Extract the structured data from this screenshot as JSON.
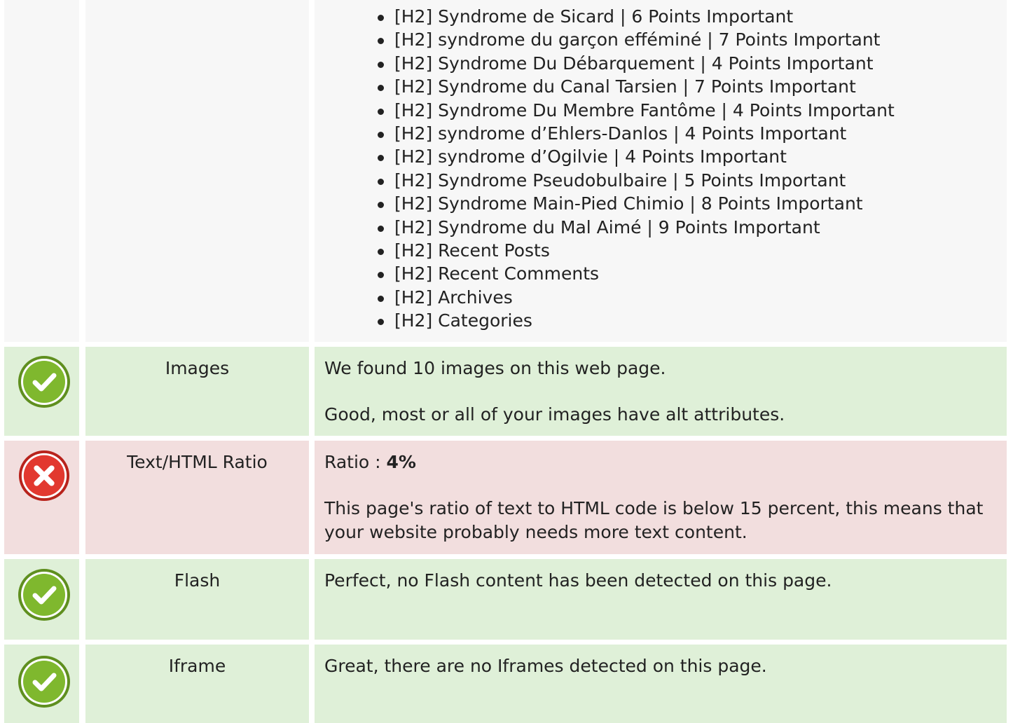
{
  "headings": {
    "items": [
      "[H2] Syndrome de Sicard | 6 Points Important",
      "[H2] syndrome du garçon efféminé | 7 Points Important",
      "[H2] Syndrome Du Débarquement | 4 Points Important",
      "[H2] Syndrome du Canal Tarsien | 7 Points Important",
      "[H2] Syndrome Du Membre Fantôme | 4 Points Important",
      "[H2] syndrome d’Ehlers-Danlos | 4 Points Important",
      "[H2] syndrome d’Ogilvie | 4 Points Important",
      "[H2] Syndrome Pseudobulbaire | 5 Points Important",
      "[H2] Syndrome Main-Pied Chimio | 8 Points Important",
      "[H2] Syndrome du Mal Aimé | 9 Points Important",
      "[H2] Recent Posts",
      "[H2] Recent Comments",
      "[H2] Archives",
      "[H2] Categories"
    ]
  },
  "rows": {
    "images": {
      "status": "pass",
      "icon": "check-circle-icon",
      "label": "Images",
      "line1": "We found 10 images on this web page.",
      "line2": "Good, most or all of your images have alt attributes."
    },
    "ratio": {
      "status": "fail",
      "icon": "x-circle-icon",
      "label": "Text/HTML Ratio",
      "ratio_prefix": "Ratio : ",
      "ratio_value": "4%",
      "line2": "This page's ratio of text to HTML code is below 15 percent, this means that your website probably needs more text content."
    },
    "flash": {
      "status": "pass",
      "icon": "check-circle-icon",
      "label": "Flash",
      "line1": "Perfect, no Flash content has been detected on this page."
    },
    "iframe": {
      "status": "pass",
      "icon": "check-circle-icon",
      "label": "Iframe",
      "line1": "Great, there are no Iframes detected on this page."
    }
  },
  "colors": {
    "pass_bg": "#dff0d8",
    "fail_bg": "#f2dede",
    "neutral_bg": "#f7f7f7",
    "pass_icon": "#7fb82e",
    "fail_icon": "#e2382f"
  }
}
